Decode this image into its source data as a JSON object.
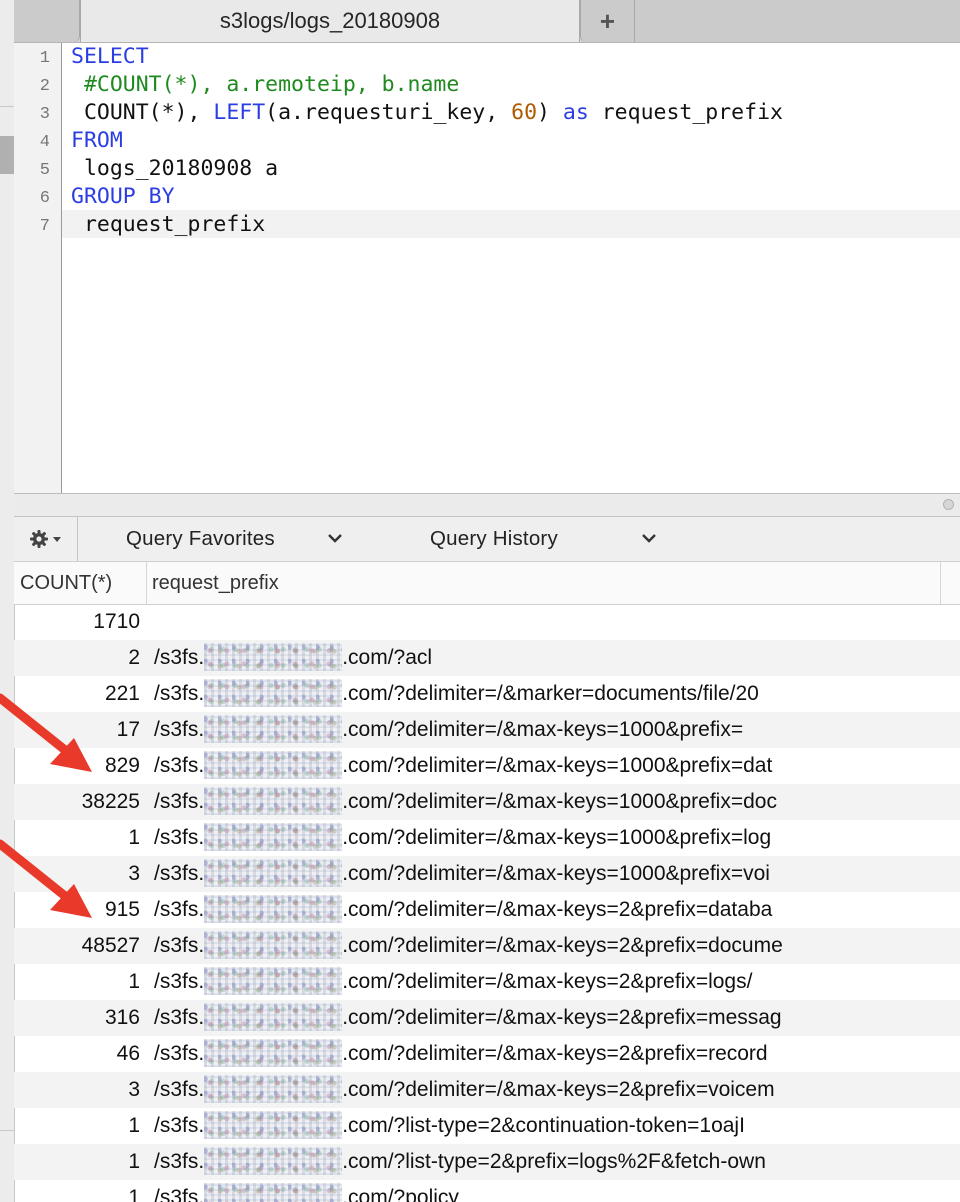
{
  "tab_bar": {
    "active_tab": "s3logs/logs_20180908",
    "new_tab_label": "+"
  },
  "editor": {
    "line_numbers": [
      "1",
      "2",
      "3",
      "4",
      "5",
      "6",
      "7"
    ],
    "lines": [
      [
        {
          "t": "SELECT",
          "c": "kw"
        }
      ],
      [
        {
          "t": " #COUNT(*), a.remoteip, b.name",
          "c": "cm"
        }
      ],
      [
        {
          "t": " COUNT(*), ",
          "c": ""
        },
        {
          "t": "LEFT",
          "c": "kw"
        },
        {
          "t": "(a.requesturi_key, ",
          "c": ""
        },
        {
          "t": "60",
          "c": "num"
        },
        {
          "t": ") ",
          "c": ""
        },
        {
          "t": "as",
          "c": "kw"
        },
        {
          "t": " request_prefix",
          "c": ""
        }
      ],
      [
        {
          "t": "FROM",
          "c": "kw"
        }
      ],
      [
        {
          "t": " logs_20180908 a",
          "c": ""
        }
      ],
      [
        {
          "t": "GROUP BY",
          "c": "kw"
        }
      ],
      [
        {
          "t": " request_prefix",
          "c": ""
        }
      ]
    ]
  },
  "toolbar": {
    "gear_icon": "gear-icon",
    "favorites_label": "Query Favorites",
    "history_label": "Query History"
  },
  "results": {
    "columns": [
      "COUNT(*)",
      "request_prefix"
    ],
    "rows": [
      {
        "count": "1710",
        "pre": "",
        "post": ""
      },
      {
        "count": "2",
        "pre": "/s3fs.",
        "post": ".com/?acl"
      },
      {
        "count": "221",
        "pre": "/s3fs.",
        "post": ".com/?delimiter=/&marker=documents/file/20"
      },
      {
        "count": "17",
        "pre": "/s3fs.",
        "post": ".com/?delimiter=/&max-keys=1000&prefix="
      },
      {
        "count": "829",
        "pre": "/s3fs.",
        "post": ".com/?delimiter=/&max-keys=1000&prefix=dat"
      },
      {
        "count": "38225",
        "pre": "/s3fs.",
        "post": ".com/?delimiter=/&max-keys=1000&prefix=doc"
      },
      {
        "count": "1",
        "pre": "/s3fs.",
        "post": ".com/?delimiter=/&max-keys=1000&prefix=log"
      },
      {
        "count": "3",
        "pre": "/s3fs.",
        "post": ".com/?delimiter=/&max-keys=1000&prefix=voi"
      },
      {
        "count": "915",
        "pre": "/s3fs.",
        "post": ".com/?delimiter=/&max-keys=2&prefix=databa"
      },
      {
        "count": "48527",
        "pre": "/s3fs.",
        "post": ".com/?delimiter=/&max-keys=2&prefix=docume"
      },
      {
        "count": "1",
        "pre": "/s3fs.",
        "post": ".com/?delimiter=/&max-keys=2&prefix=logs/"
      },
      {
        "count": "316",
        "pre": "/s3fs.",
        "post": ".com/?delimiter=/&max-keys=2&prefix=messag"
      },
      {
        "count": "46",
        "pre": "/s3fs.",
        "post": ".com/?delimiter=/&max-keys=2&prefix=record"
      },
      {
        "count": "3",
        "pre": "/s3fs.",
        "post": ".com/?delimiter=/&max-keys=2&prefix=voicem"
      },
      {
        "count": "1",
        "pre": "/s3fs.",
        "post": ".com/?list-type=2&continuation-token=1oajI"
      },
      {
        "count": "1",
        "pre": "/s3fs.",
        "post": ".com/?list-type=2&prefix=logs%2F&fetch-own"
      },
      {
        "count": "1",
        "pre": "/s3fs.",
        "post": ".com/?policy"
      }
    ]
  },
  "colors": {
    "keyword": "#2b3ee3",
    "comment": "#1f8a1f",
    "number": "#b05a00",
    "arrow": "#e8392b"
  }
}
